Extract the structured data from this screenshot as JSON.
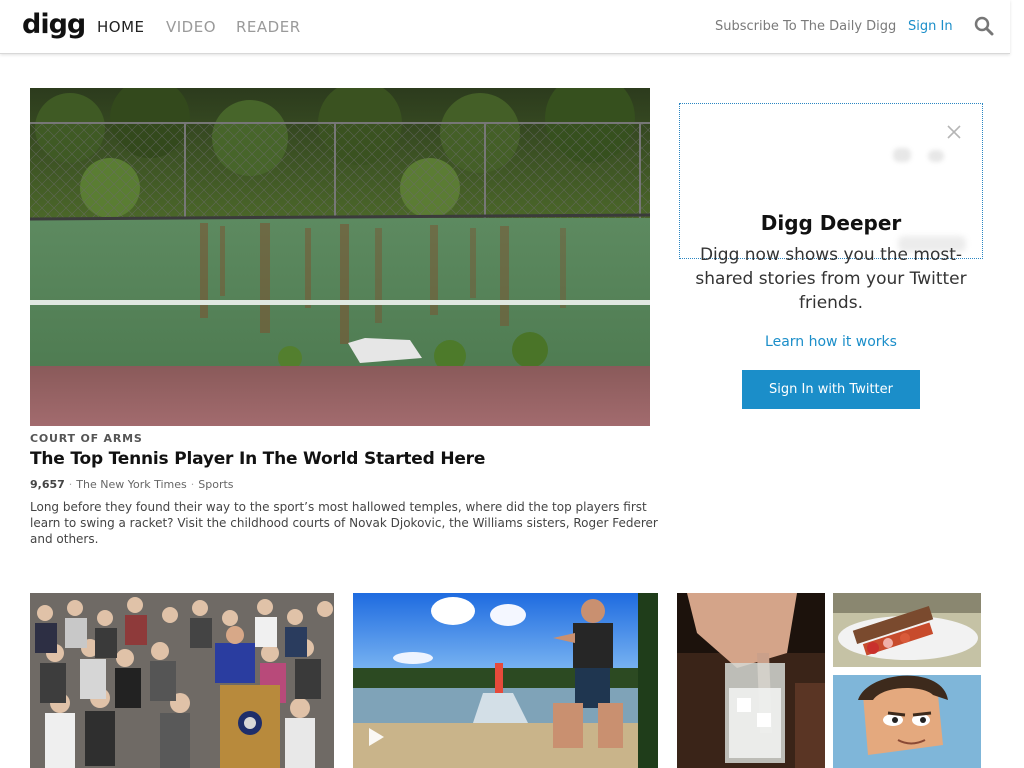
{
  "header": {
    "logo": "digg",
    "nav": [
      "HOME",
      "VIDEO",
      "READER"
    ],
    "subscribe": "Subscribe To The Daily Digg",
    "signin": "Sign In"
  },
  "hero": {
    "kicker": "COURT OF ARMS",
    "title": "The Top Tennis Player In The World Started Here",
    "count": "9,657",
    "source": "The New York Times",
    "category": "Sports",
    "separator": "·",
    "description": "Long before they found their way to the sport’s most hallowed temples, where did the top players first learn to swing a racket? Visit the childhood courts of Novak Djokovic, the Williams sisters, Roger Federer and others."
  },
  "panel": {
    "title": "Digg Deeper",
    "text": "Digg now shows you the most-shared stories from your Twitter friends.",
    "link": "Learn how it works",
    "button": "Sign In with Twitter"
  },
  "colors": {
    "accent": "#1b8ec9",
    "panel_border": "#2b86c2"
  },
  "icons": [
    "search-icon",
    "close-icon",
    "play-icon"
  ]
}
